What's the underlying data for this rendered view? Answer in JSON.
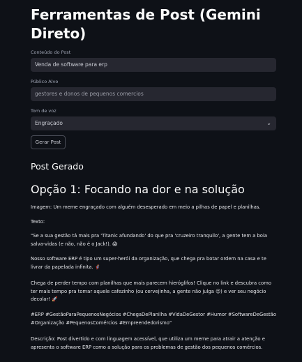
{
  "page": {
    "title": "Ferramentas de Post (Gemini Direto)"
  },
  "form": {
    "content_label": "Conteúdo do Post",
    "content_value": "Venda de software para erp",
    "audience_label": "Público Alvo",
    "audience_value": "gestores e donos de pequenos comercios",
    "tone_label": "Tom de voz",
    "tone_value": "Engraçado",
    "generate_label": "Gerar Post"
  },
  "result": {
    "heading": "Post Gerado",
    "option_title": "Opção 1: Focando na dor e na solução",
    "image_line": "Imagem: Um meme engraçado com alguém desesperado em meio a pilhas de papel e planilhas.",
    "text_label": "Texto:",
    "quote": "\"Se a sua gestão tá mais pra 'Titanic afundando' do que pra 'cruzeiro tranquilo', a gente tem a boia salva-vidas (e não, não é o Jack!). 😱",
    "para2": "Nosso software ERP é tipo um super-herói da organização, que chega pra botar ordem na casa e te livrar da papelada infinita. 🦸‍♂️",
    "para3": "Chega de perder tempo com planilhas que mais parecem hieróglifos! Clique no link e descubra como ter mais tempo pra tomar aquele cafezinho (ou cervejinha, a gente não julga 😉) e ver seu negócio decolar! 🚀",
    "hashtags": "#ERP #GestãoParaPequenosNegócios #ChegaDePlanilha #VidaDeGestor #Humor #SoftwareDeGestão #Organização #PequenosComércios #Empreendedorismo\"",
    "description": "Descrição: Post divertido e com linguagem acessível, que utiliza um meme para atrair a atenção e apresenta o software ERP como a solução para os problemas de gestão dos pequenos comércios."
  },
  "icons": {
    "select_arrow": "chevron-down-icon"
  }
}
